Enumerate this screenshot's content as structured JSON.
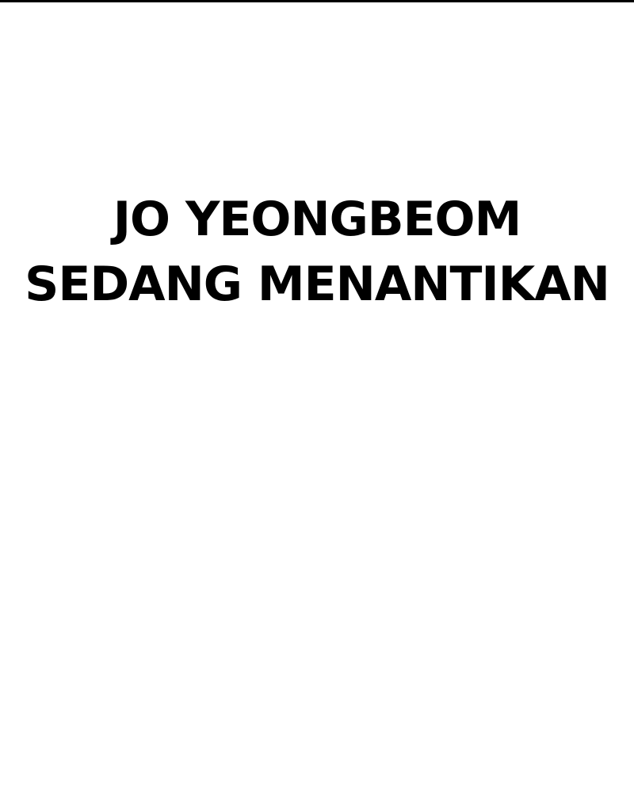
{
  "caption": {
    "line_1": "JO YEONGBEOM",
    "line_2": "SEDANG MENANTIKAN"
  },
  "colors": {
    "background": "#ffffff",
    "text": "#000000",
    "top_border": "#000000"
  }
}
